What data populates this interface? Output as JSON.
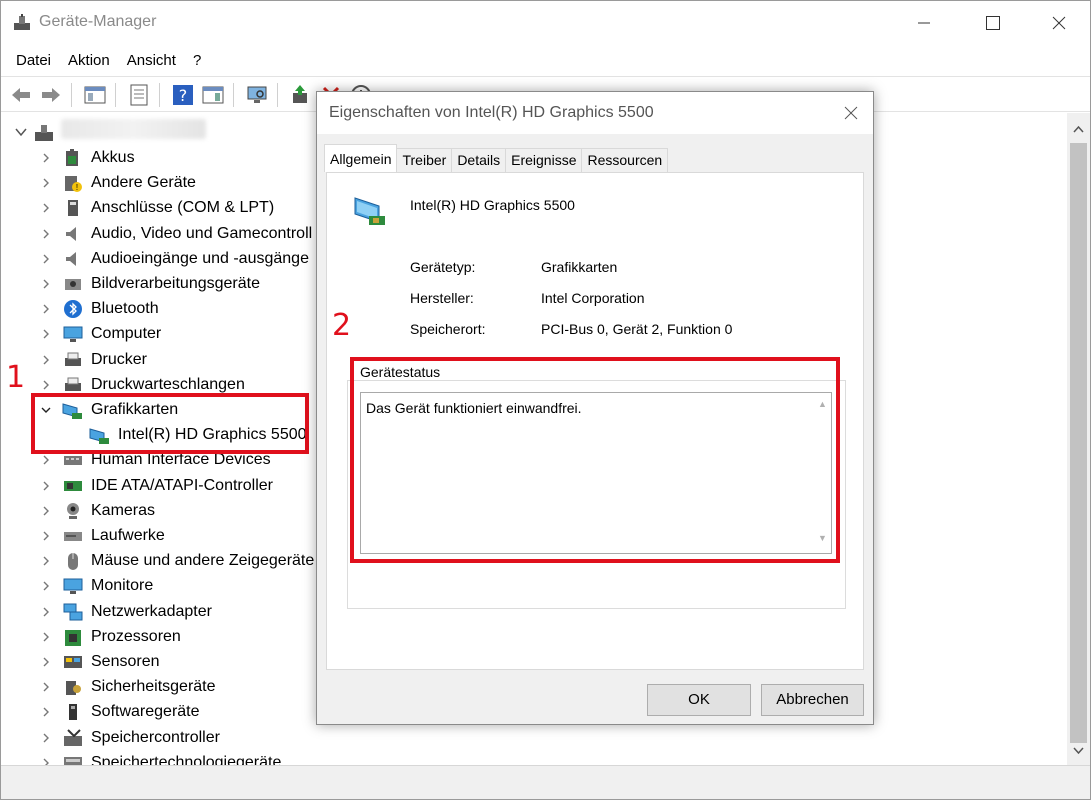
{
  "window": {
    "title": "Geräte-Manager"
  },
  "menu": [
    "Datei",
    "Aktion",
    "Ansicht",
    "?"
  ],
  "tree": {
    "items": [
      {
        "label": "Akkus",
        "icon": "battery-icon"
      },
      {
        "label": "Andere Geräte",
        "icon": "unknown-device-icon"
      },
      {
        "label": "Anschlüsse (COM & LPT)",
        "icon": "port-icon"
      },
      {
        "label": "Audio, Video und Gamecontroll",
        "icon": "speaker-icon"
      },
      {
        "label": "Audioeingänge und -ausgänge",
        "icon": "speaker-icon"
      },
      {
        "label": "Bildverarbeitungsgeräte",
        "icon": "camera-device-icon"
      },
      {
        "label": "Bluetooth",
        "icon": "bluetooth-icon"
      },
      {
        "label": "Computer",
        "icon": "computer-icon"
      },
      {
        "label": "Drucker",
        "icon": "printer-icon"
      },
      {
        "label": "Druckwarteschlangen",
        "icon": "printer-icon"
      },
      {
        "label": "Grafikkarten",
        "icon": "display-adapter-icon",
        "expanded": true
      },
      {
        "label": "Intel(R) HD Graphics 5500",
        "icon": "display-adapter-icon",
        "child": true
      },
      {
        "label": "Human Interface Devices",
        "icon": "hid-icon"
      },
      {
        "label": "IDE ATA/ATAPI-Controller",
        "icon": "ide-controller-icon"
      },
      {
        "label": "Kameras",
        "icon": "webcam-icon"
      },
      {
        "label": "Laufwerke",
        "icon": "drive-icon"
      },
      {
        "label": "Mäuse und andere Zeigegeräte",
        "icon": "mouse-icon"
      },
      {
        "label": "Monitore",
        "icon": "monitor-icon"
      },
      {
        "label": "Netzwerkadapter",
        "icon": "network-icon"
      },
      {
        "label": "Prozessoren",
        "icon": "processor-icon"
      },
      {
        "label": "Sensoren",
        "icon": "sensor-icon"
      },
      {
        "label": "Sicherheitsgeräte",
        "icon": "security-icon"
      },
      {
        "label": "Softwaregeräte",
        "icon": "software-device-icon"
      },
      {
        "label": "Speichercontroller",
        "icon": "storage-controller-icon"
      },
      {
        "label": "Speichertechnologiegeräte",
        "icon": "storage-tech-icon"
      }
    ]
  },
  "annotations": {
    "one": "1",
    "two": "2"
  },
  "dialog": {
    "title": "Eigenschaften von Intel(R) HD Graphics 5500",
    "tabs": [
      "Allgemein",
      "Treiber",
      "Details",
      "Ereignisse",
      "Ressourcen"
    ],
    "device_name": "Intel(R) HD Graphics 5500",
    "props": {
      "type_label": "Gerätetyp:",
      "type_value": "Grafikkarten",
      "vendor_label": "Hersteller:",
      "vendor_value": "Intel Corporation",
      "location_label": "Speicherort:",
      "location_value": "PCI-Bus 0, Gerät 2, Funktion 0"
    },
    "status_title": "Gerätestatus",
    "status_text": "Das Gerät funktioniert einwandfrei.",
    "ok_label": "OK",
    "cancel_label": "Abbrechen"
  },
  "colors": {
    "annotation": "#e0101c"
  }
}
